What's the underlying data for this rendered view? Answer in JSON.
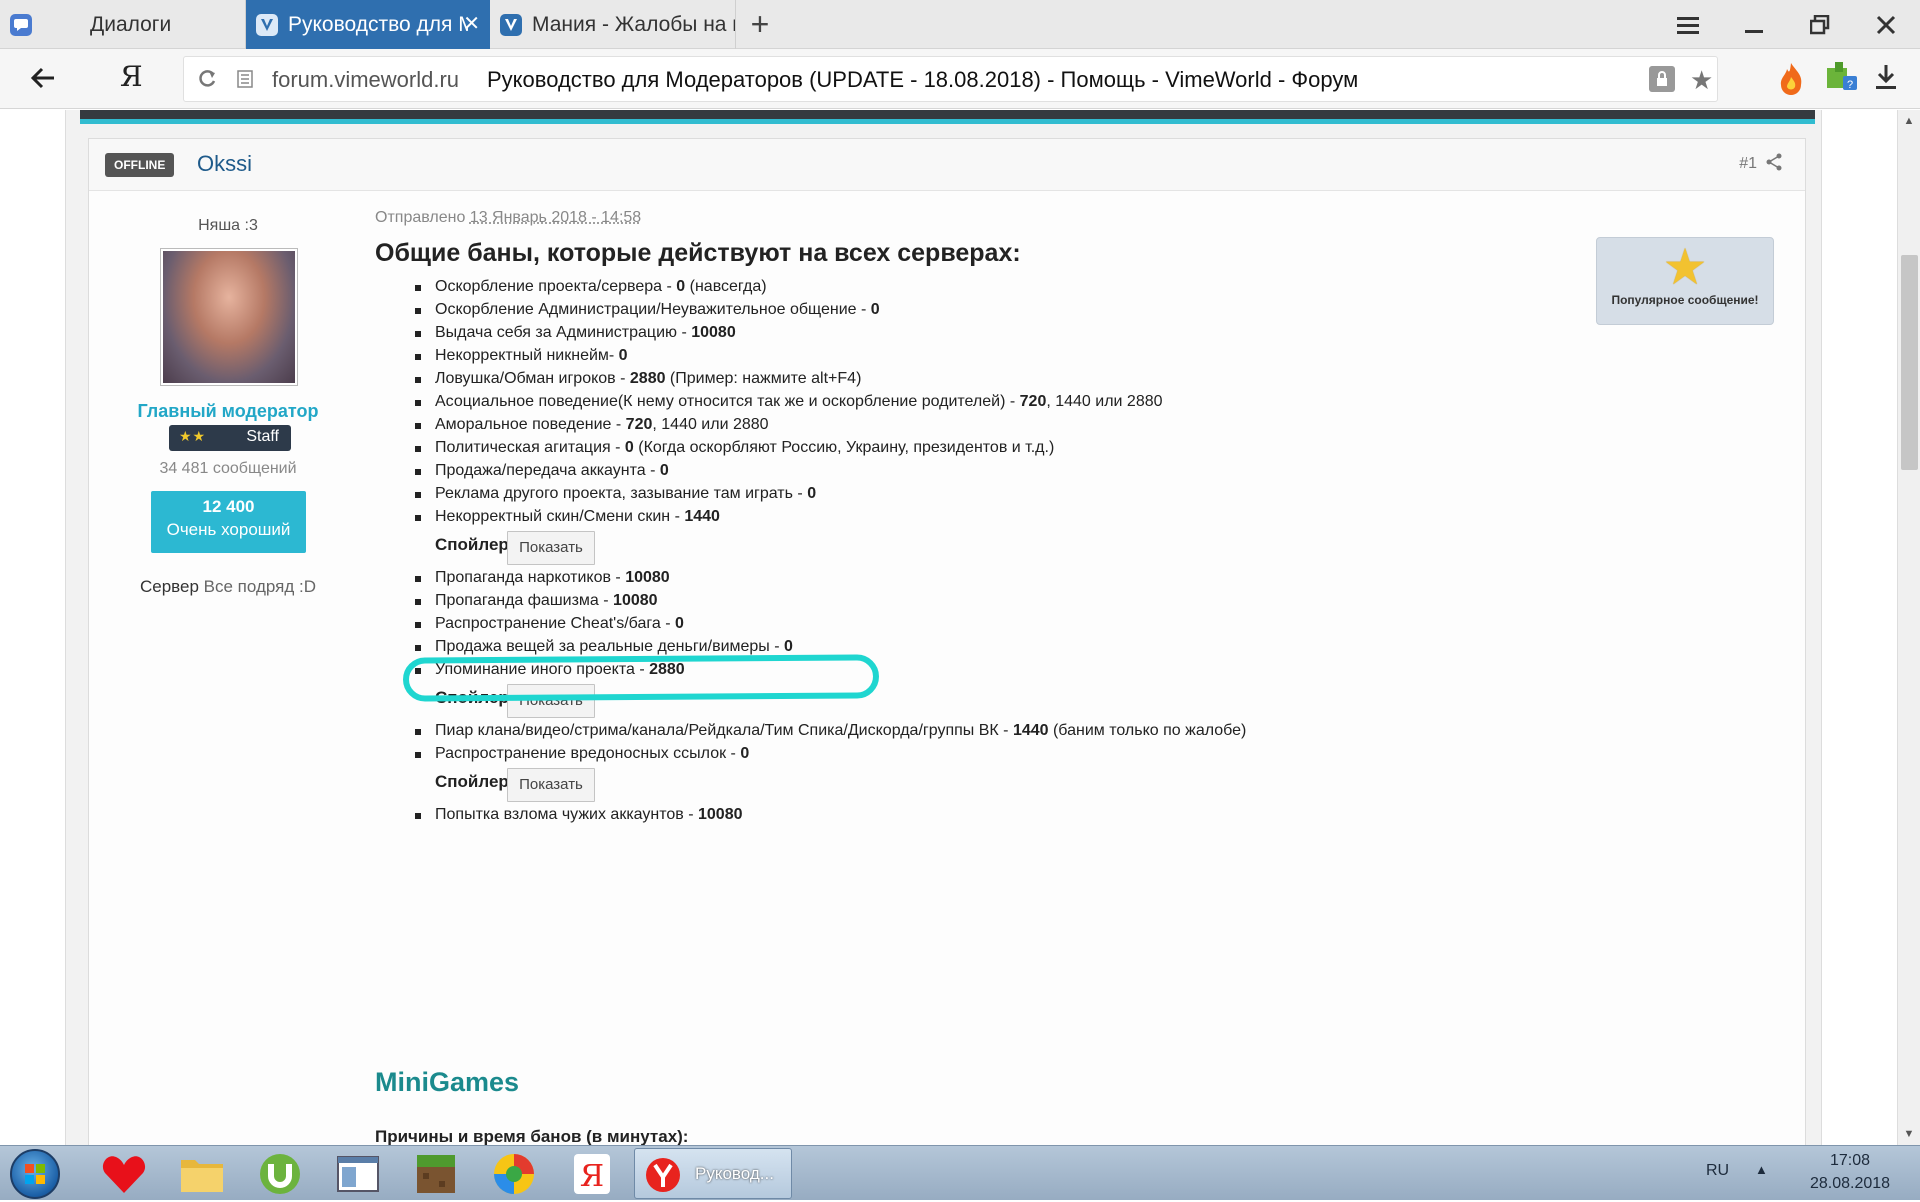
{
  "browser": {
    "tabs": [
      {
        "label": "Диалоги",
        "icon": "chat-icon"
      },
      {
        "label": "Руководство для Модераторов",
        "icon": "vimeworld-icon"
      },
      {
        "label": "Мания - Жалобы на персонал",
        "icon": "vimeworld-icon"
      }
    ],
    "new_tab": "+",
    "address": {
      "domain": "forum.vimeworld.ru",
      "title": "Руководство для Модераторов (UPDATE - 18.08.2018) - Помощь - VimeWorld - Форум"
    },
    "yandex_logo": "Я"
  },
  "post": {
    "status": "OFFLINE",
    "author": "Okssi",
    "number": "#1",
    "sidebar": {
      "rank_title": "Няша :3",
      "group": "Главный модератор",
      "badge_stars": "★★",
      "badge_label": "Staff",
      "messages": "34 481 сообщений",
      "reputation": "12 400",
      "reputation_label": "Очень хороший",
      "server_label": "Сервер",
      "server_value": "Все подряд :D"
    },
    "sent_prefix": "Отправлено",
    "sent_date": "13 Январь 2018 - 14:58",
    "title": "Общие баны, которые действуют на всех серверах:",
    "popular_label": "Популярное сообщение!",
    "spoiler_label": "Спойлер",
    "spoiler_button": "Показать",
    "items": [
      {
        "text": "Оскорбление проекта/сервера - ",
        "bold": "0",
        "rest": "  (навсегда)"
      },
      {
        "text": "Оскорбление Администрации/Неуважительное общение - ",
        "bold": "0",
        "rest": ""
      },
      {
        "text": "Выдача себя за Администрацию - ",
        "bold": "10080",
        "rest": ""
      },
      {
        "text": "Некорректный никнейм- ",
        "bold": "0",
        "rest": ""
      },
      {
        "text": "Ловушка/Обман игроков - ",
        "bold": "2880",
        "rest": " (Пример: нажмите alt+F4)"
      },
      {
        "text": "Асоциальное поведение(К нему относится так же и оскорбление родителей) - ",
        "bold": "720",
        "rest": ", 1440 или 2880"
      },
      {
        "text": "Аморальное поведение - ",
        "bold": "720",
        "rest": ", 1440 или 2880"
      },
      {
        "text": "Политическая агитация - ",
        "bold": "0",
        "rest": " (Когда оскорбляют Россию, Украину, президентов и т.д.)"
      },
      {
        "text": "Продажа/передача аккаунта - ",
        "bold": "0",
        "rest": ""
      },
      {
        "text": "Реклама другого проекта, зазывание там играть - ",
        "bold": "0",
        "rest": ""
      },
      {
        "text": "Некорректный скин/Смени скин - ",
        "bold": "1440",
        "rest": ""
      },
      {
        "text": "Пропаганда наркотиков - ",
        "bold": "10080",
        "rest": ""
      },
      {
        "text": "Пропаганда фашизма - ",
        "bold": "10080",
        "rest": ""
      },
      {
        "text": "Распространение Cheat's/бага - ",
        "bold": "0",
        "rest": ""
      },
      {
        "text": "Продажа вещей за реальные деньги/вимеры - ",
        "bold": "0",
        "rest": ""
      },
      {
        "text": "Упоминание иного проекта - ",
        "bold": "2880",
        "rest": ""
      },
      {
        "text": "Пиар клана/видео/стрима/канала/Рейдкала/Тим Спика/Дискорда/группы ВК - ",
        "bold": "1440",
        "rest": " (баним только по жалобе)"
      },
      {
        "text": "Распространение вредоносных ссылок - ",
        "bold": "0",
        "rest": ""
      },
      {
        "text": "Попытка взлома чужих аккаунтов - ",
        "bold": "10080",
        "rest": ""
      }
    ],
    "section_title": "MiniGames",
    "section_sub": "Причины и время банов (в минутах):"
  },
  "taskbar": {
    "active_label": "Руковод...",
    "lang": "RU",
    "time": "17:08",
    "date": "28.08.2018"
  },
  "colors": {
    "tab_active": "#2f6faf",
    "accent_cyan": "#2cb8d2",
    "highlight_ring": "#1fd6d0",
    "section_title": "#1b8a8d"
  }
}
